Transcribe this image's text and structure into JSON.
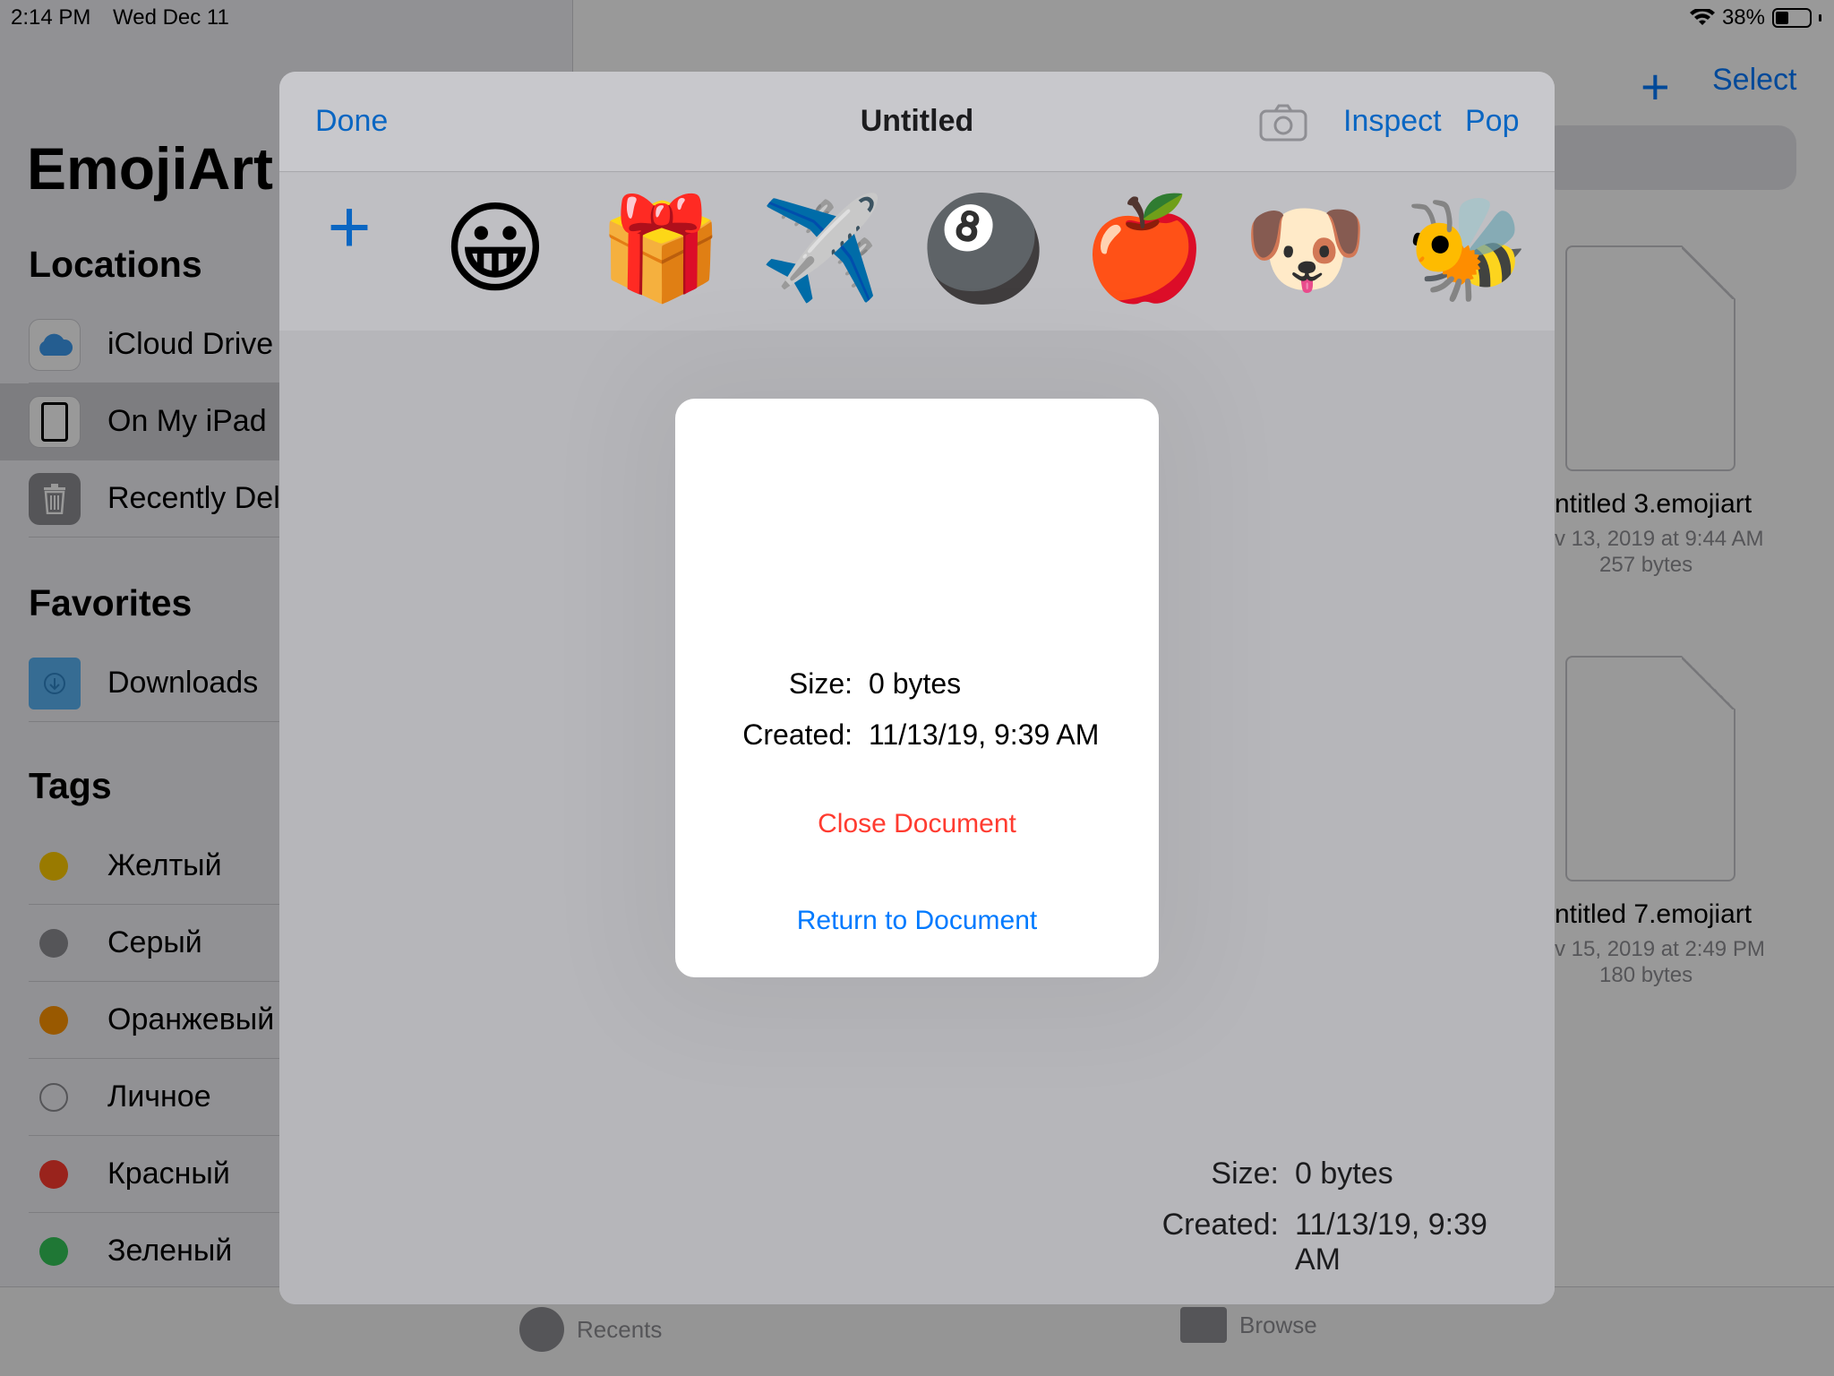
{
  "status_bar": {
    "time": "2:14 PM",
    "date": "Wed Dec 11",
    "battery": "38%"
  },
  "sidebar": {
    "app_title": "EmojiArt",
    "locations_title": "Locations",
    "locations": [
      {
        "label": "iCloud Drive",
        "icon": "icloud-icon"
      },
      {
        "label": "On My iPad",
        "icon": "ipad-icon",
        "selected": true
      },
      {
        "label": "Recently Del",
        "icon": "trash-icon"
      }
    ],
    "favorites_title": "Favorites",
    "favorites": [
      {
        "label": "Downloads",
        "icon": "downloads-folder-icon"
      }
    ],
    "tags_title": "Tags",
    "tags": [
      {
        "label": "Желтый",
        "color": "#ffcc00"
      },
      {
        "label": "Серый",
        "color": "#8e8e93"
      },
      {
        "label": "Оранжевый",
        "color": "#ff9500"
      },
      {
        "label": "Личное",
        "color": ""
      },
      {
        "label": "Красный",
        "color": "#ff3b30"
      },
      {
        "label": "Зеленый",
        "color": "#34c759"
      }
    ]
  },
  "browser": {
    "select_label": "Select",
    "files": [
      {
        "name": "ntitled 3.emojiart",
        "date": "v 13, 2019 at 9:44 AM",
        "size": "257 bytes"
      },
      {
        "name": "ntitled 7.emojiart",
        "date": "v 15, 2019 at 2:49 PM",
        "size": "180 bytes"
      }
    ]
  },
  "tabbar": {
    "recents": "Recents",
    "browse": "Browse"
  },
  "document": {
    "done_label": "Done",
    "title": "Untitled",
    "inspect_label": "Inspect",
    "pop_label": "Pop",
    "add_label": "+",
    "palette": [
      "😀",
      "🎁",
      "✈️",
      "🎱",
      "🍎",
      "🐶",
      "🐝"
    ],
    "info": {
      "size_key": "Size:",
      "size_val": "0 bytes",
      "created_key": "Created:",
      "created_val": "11/13/19, 9:39 AM"
    }
  },
  "popover": {
    "size_key": "Size:",
    "size_val": "0 bytes",
    "created_key": "Created:",
    "created_val": "11/13/19, 9:39 AM",
    "close_label": "Close Document",
    "return_label": "Return to Document"
  },
  "colors": {
    "accent": "#007aff",
    "destructive": "#ff3b30"
  }
}
